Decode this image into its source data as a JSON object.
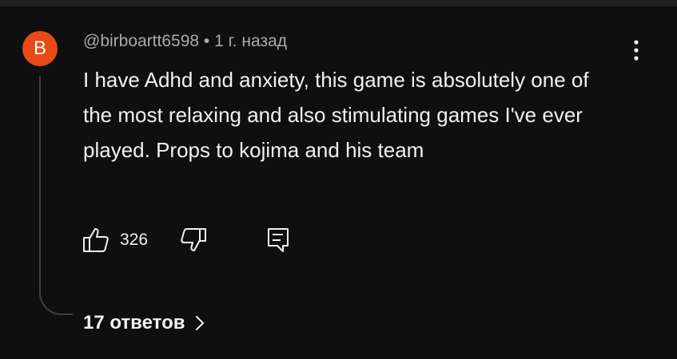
{
  "comment": {
    "avatar_letter": "B",
    "author": "@birboartt6598",
    "separator": "•",
    "time_ago": "1 г. назад",
    "text": "I have Adhd and anxiety, this game is absolutely one of the most relaxing and also stimulating games I've ever played. Props to kojima and his team",
    "like_count": "326",
    "replies_label": "17 ответов"
  },
  "icons": {
    "more": "more-vert-icon",
    "like": "thumb-up-icon",
    "dislike": "thumb-down-icon",
    "reply": "reply-comment-icon",
    "chevron": "chevron-right-icon"
  },
  "colors": {
    "background": "#0f0f0f",
    "avatar": "#e64a19",
    "text_primary": "#f1f1f1",
    "text_secondary": "#aaaaaa",
    "thread_line": "#3f3f3f"
  }
}
